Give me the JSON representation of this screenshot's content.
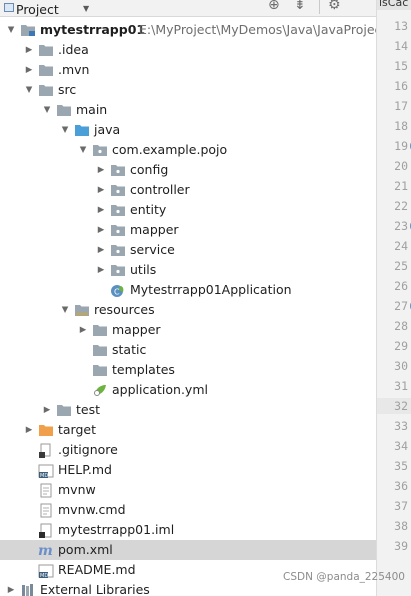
{
  "toolbar": {
    "title": "Project",
    "icons": [
      "crosshair-icon",
      "collapse-all-icon",
      "settings-icon"
    ]
  },
  "editor_tab_fragment": "isCac",
  "tree": [
    {
      "label": "mytestrrapp01",
      "path": "E:\\MyProject\\MyDemos\\Java\\JavaProject",
      "level": 0,
      "expanded": true,
      "icon": "module-folder",
      "bold": true
    },
    {
      "label": ".idea",
      "level": 1,
      "expanded": false,
      "icon": "folder"
    },
    {
      "label": ".mvn",
      "level": 1,
      "expanded": false,
      "icon": "folder"
    },
    {
      "label": "src",
      "level": 1,
      "expanded": true,
      "icon": "folder"
    },
    {
      "label": "main",
      "level": 2,
      "expanded": true,
      "icon": "folder"
    },
    {
      "label": "java",
      "level": 3,
      "expanded": true,
      "icon": "source-folder"
    },
    {
      "label": "com.example.pojo",
      "level": 4,
      "expanded": true,
      "icon": "package"
    },
    {
      "label": "config",
      "level": 5,
      "expanded": false,
      "icon": "package"
    },
    {
      "label": "controller",
      "level": 5,
      "expanded": false,
      "icon": "package"
    },
    {
      "label": "entity",
      "level": 5,
      "expanded": false,
      "icon": "package"
    },
    {
      "label": "mapper",
      "level": 5,
      "expanded": false,
      "icon": "package"
    },
    {
      "label": "service",
      "level": 5,
      "expanded": false,
      "icon": "package"
    },
    {
      "label": "utils",
      "level": 5,
      "expanded": false,
      "icon": "package"
    },
    {
      "label": "Mytestrrapp01Application",
      "level": 5,
      "icon": "spring-class"
    },
    {
      "label": "resources",
      "level": 3,
      "expanded": true,
      "icon": "resources-folder"
    },
    {
      "label": "mapper",
      "level": 4,
      "expanded": false,
      "icon": "folder"
    },
    {
      "label": "static",
      "level": 4,
      "icon": "folder"
    },
    {
      "label": "templates",
      "level": 4,
      "icon": "folder"
    },
    {
      "label": "application.yml",
      "level": 4,
      "icon": "yml-file"
    },
    {
      "label": "test",
      "level": 2,
      "expanded": false,
      "icon": "folder"
    },
    {
      "label": "target",
      "level": 1,
      "expanded": false,
      "icon": "excluded-folder"
    },
    {
      "label": ".gitignore",
      "level": 1,
      "icon": "gitignore-file"
    },
    {
      "label": "HELP.md",
      "level": 1,
      "icon": "md-file"
    },
    {
      "label": "mvnw",
      "level": 1,
      "icon": "text-file"
    },
    {
      "label": "mvnw.cmd",
      "level": 1,
      "icon": "text-file"
    },
    {
      "label": "mytestrrapp01.iml",
      "level": 1,
      "icon": "iml-file"
    },
    {
      "label": "pom.xml",
      "level": 1,
      "icon": "maven-file",
      "selected": true
    },
    {
      "label": "README.md",
      "level": 1,
      "icon": "md-file"
    },
    {
      "label": "External Libraries",
      "level": 0,
      "expanded": false,
      "icon": "libraries"
    }
  ],
  "line_numbers": [
    "13",
    "14",
    "15",
    "16",
    "17",
    "18",
    "19",
    "20",
    "21",
    "22",
    "23",
    "24",
    "25",
    "26",
    "27",
    "28",
    "29",
    "30",
    "31",
    "32",
    "33",
    "34",
    "35",
    "36",
    "37",
    "38",
    "39"
  ],
  "current_line": "32",
  "gutter_marks": [
    "19",
    "23",
    "27"
  ],
  "watermark": "CSDN @panda_225400",
  "colors": {
    "selection": "#d6d6d6",
    "folder": "#9aa7b0",
    "source_folder": "#4a9fd8",
    "package": "#9aa7b0",
    "excluded_folder": "#f0a04b",
    "spring": "#6db33f",
    "gutter": "#f2f2f2"
  }
}
